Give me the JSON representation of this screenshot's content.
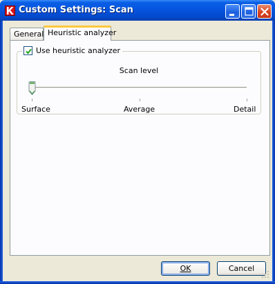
{
  "window": {
    "title": "Custom Settings: Scan",
    "app_icon": "kaspersky-k-icon",
    "controls": [
      "minimize",
      "maximize",
      "close"
    ]
  },
  "tabs": [
    {
      "label": "General",
      "selected": false
    },
    {
      "label": "Heuristic analyzer",
      "selected": true
    }
  ],
  "heuristic": {
    "enable_label": "Use heuristic analyzer",
    "enable_checked": true,
    "scan_level_title": "Scan level",
    "levels": [
      "Surface",
      "Average",
      "Detail"
    ],
    "selected_level": "Surface"
  },
  "buttons": {
    "ok": "OK",
    "cancel": "Cancel"
  },
  "colors": {
    "titlebar": "#0553dd",
    "tab_highlight": "#ffc83c",
    "thumb_accent": "#3c9e3c"
  }
}
